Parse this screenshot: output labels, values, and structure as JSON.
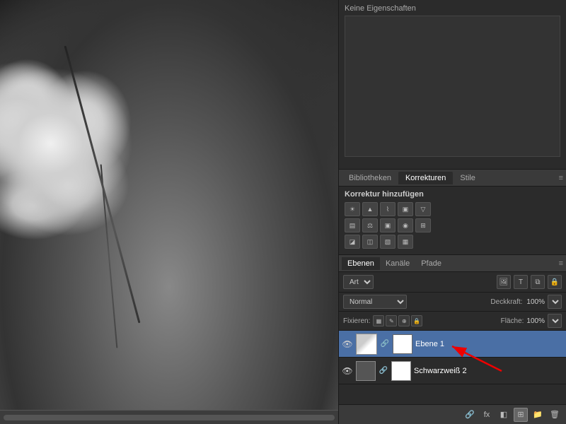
{
  "canvas": {
    "scrollbar_label": "scrollbar"
  },
  "properties_panel": {
    "title": "Keine Eigenschaften"
  },
  "tabs": {
    "bibliotheken": "Bibliotheken",
    "korrekturen": "Korrekturen",
    "stile": "Stile",
    "menu_icon": "≡"
  },
  "adjustments": {
    "title": "Korrektur hinzufügen",
    "icons_row1": [
      "☀",
      "▲▲",
      "▣",
      "◧",
      "▽"
    ],
    "icons_row2": [
      "▤",
      "⚖",
      "▣",
      "◉",
      "⊞"
    ],
    "icons_row3": [
      "◪",
      "◫",
      "◬",
      "▧",
      "▦"
    ]
  },
  "layers": {
    "tabs": {
      "ebenen": "Ebenen",
      "kanaele": "Kanäle",
      "pfade": "Pfade",
      "menu_icon": "≡"
    },
    "controls": {
      "type_select": "Art",
      "type_arrow": "▾",
      "icons": [
        "🖼",
        "T",
        "⧉",
        "🔒"
      ],
      "blend_mode": "Normal",
      "opacity_label": "Deckkraft:",
      "opacity_value": "100%",
      "opacity_arrow": "▾",
      "fixieren_label": "Fixieren:",
      "lock_icons": [
        "▦",
        "✎",
        "⊕",
        "🔒"
      ],
      "flaeche_label": "Fläche:",
      "flaeche_value": "100%",
      "flaeche_arrow": "▾"
    },
    "items": [
      {
        "name": "Ebene 1",
        "visible": true,
        "active": true,
        "has_mask": true,
        "thumb_color": "#555"
      },
      {
        "name": "Schwarzweiß 2",
        "visible": true,
        "active": false,
        "has_mask": true,
        "thumb_color": "#888"
      }
    ],
    "bottom_bar": {
      "fx_label": "fx",
      "icons": [
        "⭕",
        "fx",
        "▣",
        "🗂",
        "🗑"
      ]
    }
  }
}
